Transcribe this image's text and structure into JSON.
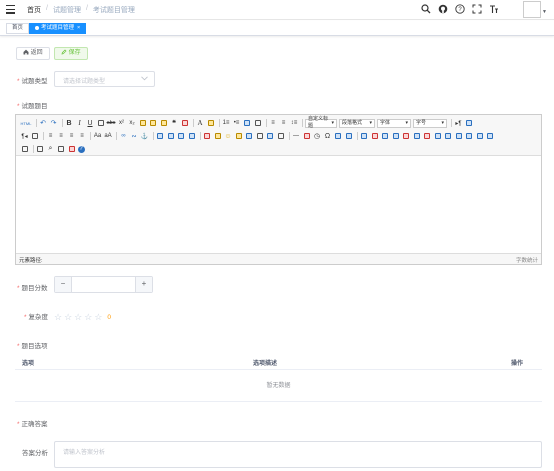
{
  "navbar": {
    "breadcrumb": [
      "首页",
      "试题管理",
      "考试题目管理"
    ],
    "separator": "/",
    "icons": [
      "search-icon",
      "github-icon",
      "help-icon",
      "fullscreen-icon",
      "font-size-icon"
    ]
  },
  "tags": [
    {
      "label": "首页",
      "active": false
    },
    {
      "label": "考试题目管理",
      "active": true,
      "close": "×"
    }
  ],
  "actions": {
    "back_label": "返回",
    "save_label": "保存"
  },
  "form": {
    "type_label": "试题类型",
    "type_placeholder": "请选择试题类型",
    "title_label": "试题题目",
    "score_label": "题目分数",
    "score_minus": "−",
    "score_plus": "+",
    "score_value": "",
    "difficulty_label": "复杂度",
    "difficulty_value": "0",
    "options_label": "题目选项",
    "answer_label": "正确答案",
    "analysis_label": "答案分析",
    "analysis_placeholder": "请输入答案分析"
  },
  "editor": {
    "combos": {
      "custom_title": "自定义标题",
      "paragraph": "段落格式",
      "font_family": "字体",
      "font_size": "字号"
    },
    "status_path": "元素路径:",
    "status_count": "字数统计"
  },
  "options_table": {
    "columns": [
      "选项",
      "选项描述",
      "操作"
    ],
    "empty_text": "暂无数据"
  },
  "colors": {
    "primary": "#1890ff",
    "success": "#67c23a",
    "required": "#f56c6c",
    "star": "#ff9900"
  }
}
